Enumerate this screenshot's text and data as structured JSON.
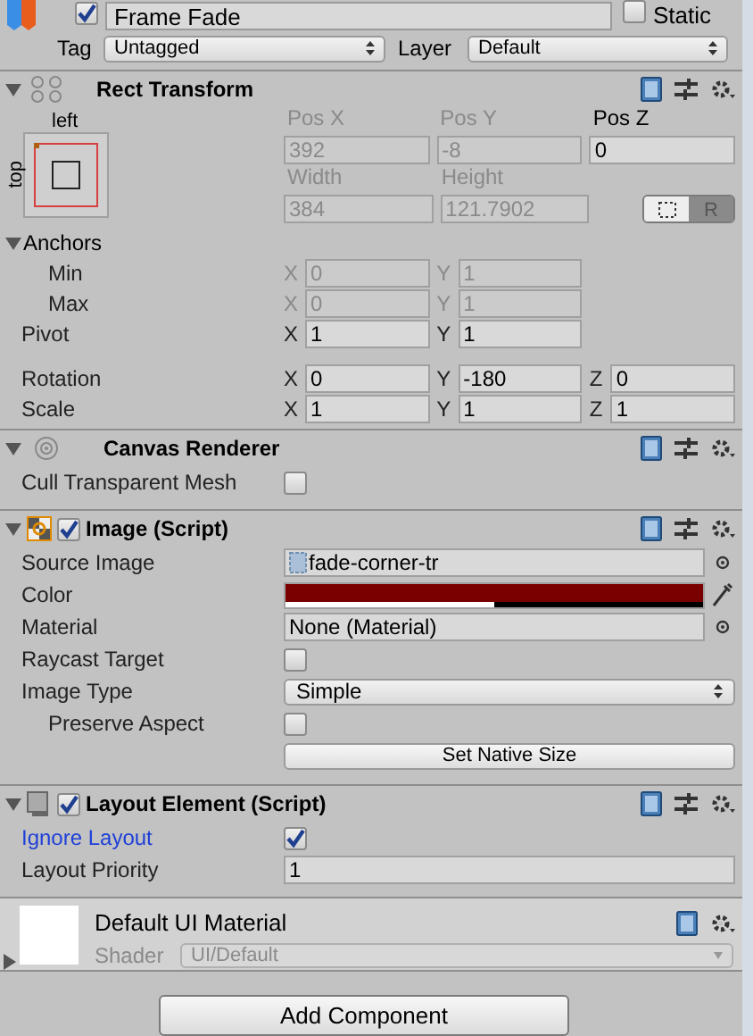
{
  "header": {
    "name": "Frame Fade",
    "active": true,
    "static_label": "Static",
    "static": false
  },
  "tag_row": {
    "tag_label": "Tag",
    "tag": "Untagged",
    "layer_label": "Layer",
    "layer": "Default"
  },
  "rect_transform": {
    "title": "Rect Transform",
    "expanded": true,
    "anchor_preset": {
      "horizontal": "left",
      "vertical": "top"
    },
    "position_fields": [
      {
        "label": "Pos X",
        "value": "392",
        "disabled": true
      },
      {
        "label": "Pos Y",
        "value": "-8",
        "disabled": true
      },
      {
        "label": "Pos Z",
        "value": "0",
        "disabled": false
      }
    ],
    "size_fields": [
      {
        "label": "Width",
        "value": "384",
        "disabled": true
      },
      {
        "label": "Height",
        "value": "121.7902",
        "disabled": true
      }
    ],
    "raw_edit_button": "R",
    "raw_edit": true,
    "anchors": {
      "label": "Anchors",
      "expanded": true,
      "rows": [
        {
          "label": "Min",
          "fields": [
            {
              "axis": "X",
              "value": "0",
              "disabled": true
            },
            {
              "axis": "Y",
              "value": "1",
              "disabled": true
            }
          ]
        },
        {
          "label": "Max",
          "fields": [
            {
              "axis": "X",
              "value": "0",
              "disabled": true
            },
            {
              "axis": "Y",
              "value": "1",
              "disabled": true
            }
          ]
        }
      ]
    },
    "vector_rows": [
      {
        "label": "Pivot",
        "fields": [
          {
            "axis": "X",
            "value": "1",
            "disabled": false
          },
          {
            "axis": "Y",
            "value": "1",
            "disabled": false
          }
        ]
      },
      {
        "label": "Rotation",
        "fields": [
          {
            "axis": "X",
            "value": "0",
            "disabled": false
          },
          {
            "axis": "Y",
            "value": "-180",
            "disabled": false
          },
          {
            "axis": "Z",
            "value": "0",
            "disabled": false
          }
        ]
      },
      {
        "label": "Scale",
        "fields": [
          {
            "axis": "X",
            "value": "1",
            "disabled": false
          },
          {
            "axis": "Y",
            "value": "1",
            "disabled": false
          },
          {
            "axis": "Z",
            "value": "1",
            "disabled": false
          }
        ]
      }
    ]
  },
  "components": [
    {
      "kind": "canvas_renderer",
      "title": "Canvas Renderer",
      "expanded": true,
      "properties": [
        {
          "kind": "checkbox",
          "label": "Cull Transparent Mesh",
          "checked": false,
          "modified": false
        }
      ]
    },
    {
      "kind": "image",
      "title": "Image (Script)",
      "expanded": true,
      "enabled": true,
      "properties": [
        {
          "kind": "object",
          "label": "Source Image",
          "value": "fade-corner-tr",
          "modified": false
        },
        {
          "kind": "color",
          "label": "Color",
          "color": "#7a0000",
          "level": 0.5,
          "modified": false
        },
        {
          "kind": "object",
          "label": "Material",
          "value": "None (Material)",
          "modified": false
        },
        {
          "kind": "checkbox",
          "label": "Raycast Target",
          "checked": false,
          "modified": false
        },
        {
          "kind": "dropdown",
          "label": "Image Type",
          "value": "Simple",
          "modified": false,
          "children": [
            {
              "kind": "checkbox",
              "label": "Preserve Aspect",
              "checked": false,
              "modified": false
            }
          ]
        },
        {
          "kind": "button",
          "label": "Set Native Size"
        }
      ]
    },
    {
      "kind": "layout_element",
      "title": "Layout Element (Script)",
      "expanded": true,
      "enabled": true,
      "properties": [
        {
          "kind": "checkbox",
          "label": "Ignore Layout",
          "checked": true,
          "modified": true
        },
        {
          "kind": "text",
          "label": "Layout Priority",
          "value": "1",
          "modified": false
        }
      ]
    }
  ],
  "material": {
    "title": "Default UI Material",
    "shader_label": "Shader",
    "shader": "UI/Default",
    "expanded": false
  },
  "add_component_button": "Add Component"
}
